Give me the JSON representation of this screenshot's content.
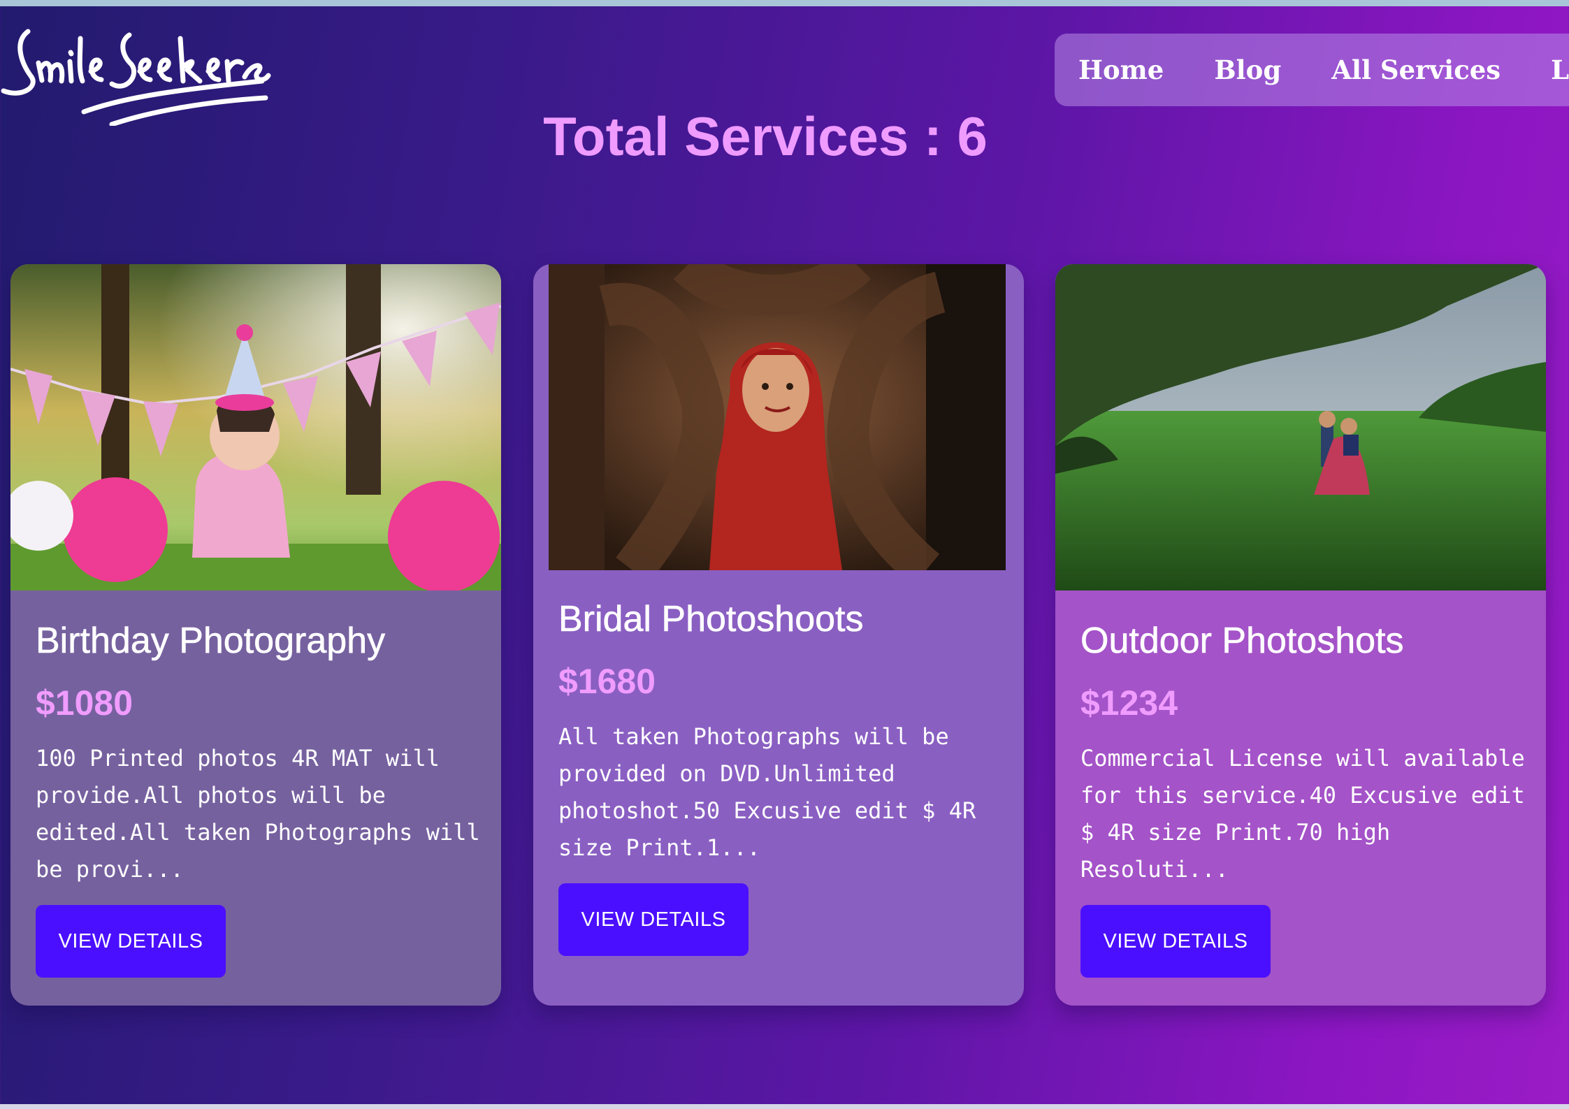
{
  "logo": {
    "text": "SmileSeekers",
    "icon": "handwritten-logo"
  },
  "nav": {
    "items": [
      "Home",
      "Blog",
      "All Services",
      "Login"
    ]
  },
  "page": {
    "title": "Total Services : 6"
  },
  "services": [
    {
      "title": "Birthday Photography",
      "price": "$1080",
      "description": "100 Printed photos 4R MAT will provide.All photos will be edited.All taken Photographs will be provi...",
      "button_label": "VIEW DETAILS",
      "image": "birthday-baby-photo"
    },
    {
      "title": "Bridal Photoshoots",
      "price": "$1680",
      "description": "All taken Photographs will be provided on DVD.Unlimited photoshot.50 Excusive edit $ 4R size Print.1...",
      "button_label": "VIEW DETAILS",
      "image": "bridal-photo"
    },
    {
      "title": "Outdoor Photoshots",
      "price": "$1234",
      "description": "Commercial License will available for this service.40 Excusive edit $ 4R size Print.70 high Resoluti...",
      "button_label": "VIEW DETAILS",
      "image": "outdoor-couple-photo"
    }
  ],
  "colors": {
    "accent_pink": "#ef9bff",
    "button_blue": "#4b0fff",
    "gradient_start": "#221b6e",
    "gradient_end": "#9a1cc6"
  }
}
